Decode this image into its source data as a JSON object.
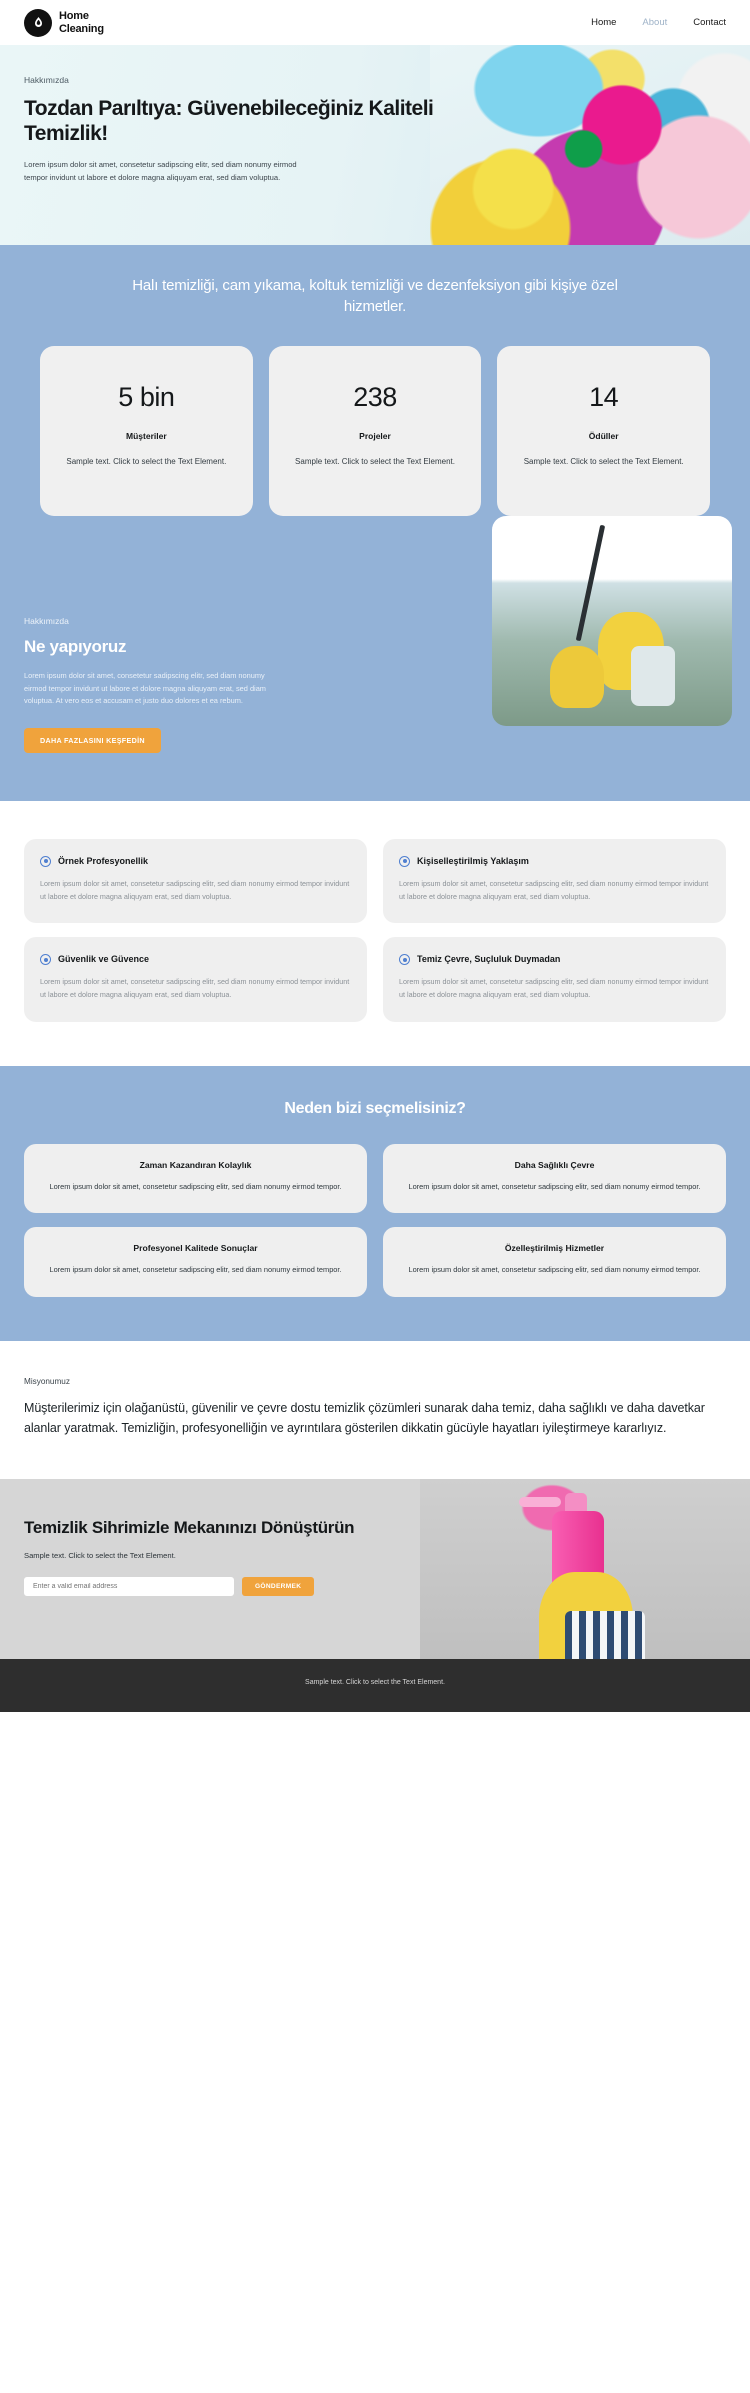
{
  "header": {
    "logo": {
      "line1": "Home",
      "line2": "Cleaning",
      "icon": "water-drop-icon"
    },
    "nav": [
      {
        "label": "Home",
        "active": false
      },
      {
        "label": "About",
        "active": true
      },
      {
        "label": "Contact",
        "active": false
      }
    ]
  },
  "hero": {
    "eyebrow": "Hakkımızda",
    "title": "Tozdan Parıltıya: Güvenebileceğiniz Kaliteli Temizlik!",
    "paragraph": "Lorem ipsum dolor sit amet, consetetur sadipscing elitr, sed diam nonumy eirmod tempor invidunt ut labore et dolore magna aliquyam erat, sed diam voluptua."
  },
  "services_band": {
    "heading": "Halı temizliği, cam yıkama, koltuk temizliği ve dezenfeksiyon gibi kişiye özel hizmetler.",
    "stats": [
      {
        "number": "5 bin",
        "label": "Müşteriler",
        "desc": "Sample text. Click to select the Text Element."
      },
      {
        "number": "238",
        "label": "Projeler",
        "desc": "Sample text. Click to select the Text Element."
      },
      {
        "number": "14",
        "label": "Ödüller",
        "desc": "Sample text. Click to select the Text Element."
      }
    ]
  },
  "about": {
    "eyebrow": "Hakkımızda",
    "title": "Ne yapıyoruz",
    "paragraph": "Lorem ipsum dolor sit amet, consetetur sadipscing elitr, sed diam nonumy eirmod tempor invidunt ut labore et dolore magna aliquyam erat, sed diam voluptua. At vero eos et accusam et justo duo dolores et ea rebum.",
    "button": "DAHA FAZLASINI KEŞFEDİN"
  },
  "features": [
    {
      "title": "Örnek Profesyonellik",
      "desc": "Lorem ipsum dolor sit amet, consetetur sadipscing elitr, sed diam nonumy eirmod tempor invidunt ut labore et dolore magna aliquyam erat, sed diam voluptua."
    },
    {
      "title": "Kişiselleştirilmiş Yaklaşım",
      "desc": "Lorem ipsum dolor sit amet, consetetur sadipscing elitr, sed diam nonumy eirmod tempor invidunt ut labore et dolore magna aliquyam erat, sed diam voluptua."
    },
    {
      "title": "Güvenlik ve Güvence",
      "desc": "Lorem ipsum dolor sit amet, consetetur sadipscing elitr, sed diam nonumy eirmod tempor invidunt ut labore et dolore magna aliquyam erat, sed diam voluptua."
    },
    {
      "title": "Temiz Çevre, Suçluluk Duymadan",
      "desc": "Lorem ipsum dolor sit amet, consetetur sadipscing elitr, sed diam nonumy eirmod tempor invidunt ut labore et dolore magna aliquyam erat, sed diam voluptua."
    }
  ],
  "why": {
    "title": "Neden bizi seçmelisiniz?",
    "cards": [
      {
        "title": "Zaman Kazandıran Kolaylık",
        "desc": "Lorem ipsum dolor sit amet, consetetur sadipscing elitr, sed diam nonumy eirmod tempor."
      },
      {
        "title": "Daha Sağlıklı Çevre",
        "desc": "Lorem ipsum dolor sit amet, consetetur sadipscing elitr, sed diam nonumy eirmod tempor."
      },
      {
        "title": "Profesyonel Kalitede Sonuçlar",
        "desc": "Lorem ipsum dolor sit amet, consetetur sadipscing elitr, sed diam nonumy eirmod tempor."
      },
      {
        "title": "Özelleştirilmiş Hizmetler",
        "desc": "Lorem ipsum dolor sit amet, consetetur sadipscing elitr, sed diam nonumy eirmod tempor."
      }
    ]
  },
  "mission": {
    "eyebrow": "Misyonumuz",
    "text": "Müşterilerimiz için olağanüstü, güvenilir ve çevre dostu temizlik çözümleri sunarak daha temiz, daha sağlıklı ve daha davetkar alanlar yaratmak. Temizliğin, profesyonelliğin ve ayrıntılara gösterilen dikkatin gücüyle hayatları iyileştirmeye kararlıyız."
  },
  "cta": {
    "title": "Temizlik Sihrimizle Mekanınızı Dönüştürün",
    "subtitle": "Sample text. Click to select the Text Element.",
    "input_placeholder": "Enter a valid email address",
    "input_value": "",
    "button": "GÖNDERMEK"
  },
  "footer": {
    "text": "Sample text. Click to select the Text Element."
  },
  "colors": {
    "blue_band": "#93b2d7",
    "orange_accent": "#f0a33c",
    "card_gray": "#efefef",
    "footer_dark": "#2e2e2e"
  }
}
